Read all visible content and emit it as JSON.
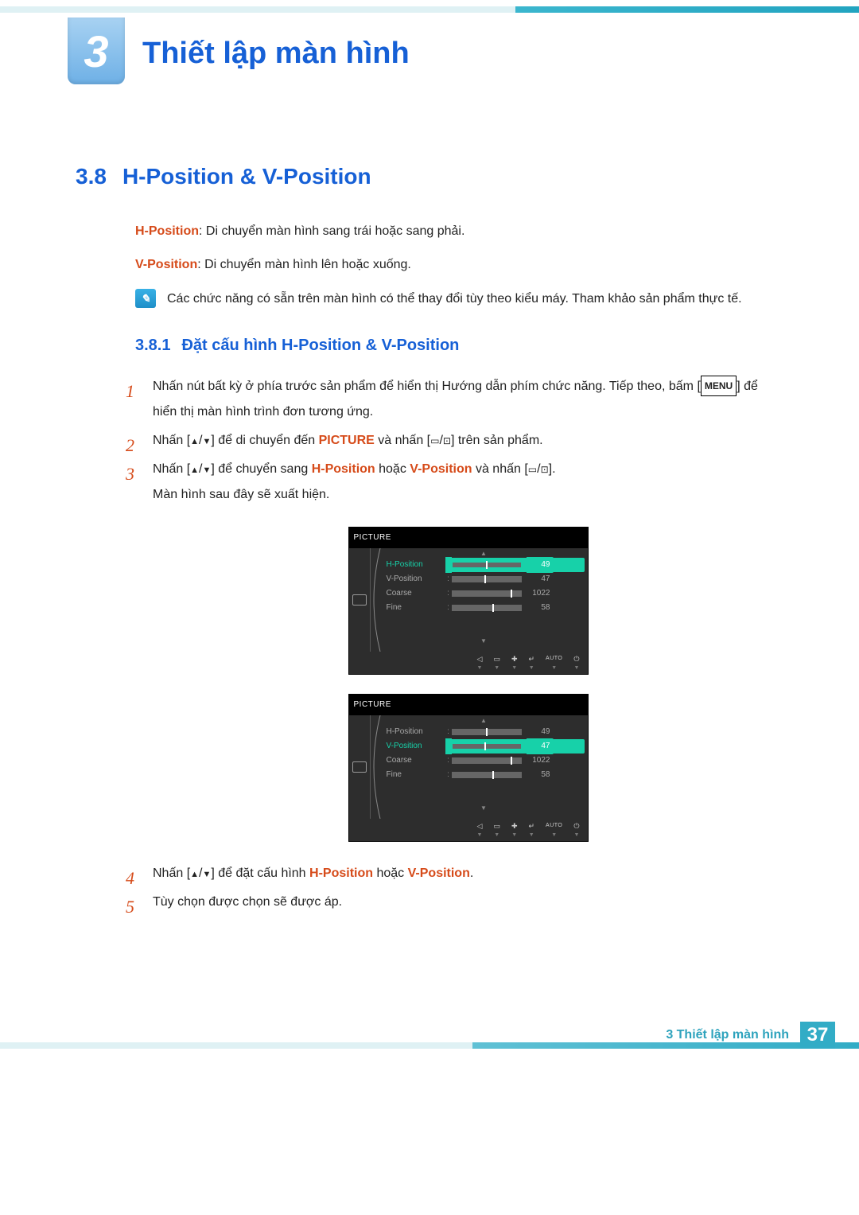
{
  "chapter": {
    "number": "3",
    "title": "Thiết lập màn hình"
  },
  "section": {
    "number": "3.8",
    "title": "H-Position & V-Position"
  },
  "definitions": {
    "h_term": "H-Position",
    "h_text": ": Di chuyển màn hình sang trái hoặc sang phải.",
    "v_term": "V-Position",
    "v_text": ": Di chuyển màn hình lên hoặc xuống."
  },
  "note": "Các chức năng có sẵn trên màn hình có thể thay đổi tùy theo kiểu máy. Tham khảo sản phẩm thực tế.",
  "subsection": {
    "number": "3.8.1",
    "title": "Đặt cấu hình H-Position & V-Position"
  },
  "steps": {
    "s1a": "Nhấn nút bất kỳ ở phía trước sản phẩm để hiển thị Hướng dẫn phím chức năng. Tiếp theo, bấm [",
    "s1_menu": "MENU",
    "s1b": "] để hiển thị màn hình trình đơn tương ứng.",
    "s2a": "Nhấn [",
    "s2b": "] để di chuyển đến ",
    "s2_kw": "PICTURE",
    "s2c": " và nhấn [",
    "s2d": "] trên sản phẩm.",
    "s3a": "Nhấn [",
    "s3b": "] để chuyển sang ",
    "s3_kw1": "H-Position",
    "s3c": " hoặc ",
    "s3_kw2": "V-Position",
    "s3d": " và nhấn [",
    "s3e": "].",
    "s3f": "Màn hình sau đây sẽ xuất hiện.",
    "s4a": "Nhấn [",
    "s4b": "] để đặt cấu hình ",
    "s4_kw1": "H-Position",
    "s4c": " hoặc ",
    "s4_kw2": "V-Position",
    "s4d": ".",
    "s5": "Tùy chọn được chọn sẽ được áp."
  },
  "osd": {
    "title": "PICTURE",
    "items": [
      {
        "label": "H-Position",
        "value": "49",
        "tick_pct": 49
      },
      {
        "label": "V-Position",
        "value": "47",
        "tick_pct": 47
      },
      {
        "label": "Coarse",
        "value": "1022",
        "tick_pct": 85
      },
      {
        "label": "Fine",
        "value": "58",
        "tick_pct": 58
      }
    ],
    "auto_label": "AUTO"
  },
  "osd_selected": {
    "panel1": 0,
    "panel2": 1
  },
  "footer": {
    "label": "3 Thiết lập màn hình",
    "page": "37"
  }
}
